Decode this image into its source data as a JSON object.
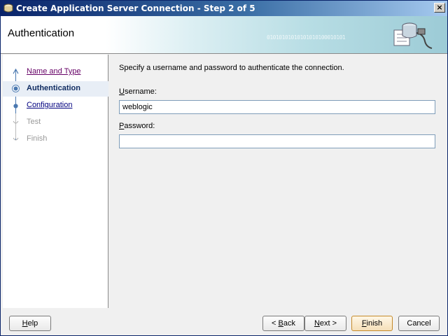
{
  "window": {
    "title": "Create Application Server Connection - Step 2 of 5",
    "close_label": "×"
  },
  "banner": {
    "title": "Authentication",
    "binary_text": "01010101010101010100010101"
  },
  "steps": [
    {
      "label": "Name and Type",
      "state": "visited"
    },
    {
      "label": "Authentication",
      "state": "current"
    },
    {
      "label": "Configuration",
      "state": "link"
    },
    {
      "label": "Test",
      "state": "disabled"
    },
    {
      "label": "Finish",
      "state": "disabled"
    }
  ],
  "content": {
    "instructions": "Specify a username and password to authenticate the connection.",
    "username": {
      "mnemonic": "U",
      "label_rest": "sername:",
      "value": "weblogic"
    },
    "password": {
      "mnemonic": "P",
      "label_rest": "assword:",
      "value": ""
    }
  },
  "buttons": {
    "help": {
      "pre": "",
      "mn": "H",
      "post": "elp"
    },
    "back": {
      "pre": "< ",
      "mn": "B",
      "post": "ack"
    },
    "next": {
      "pre": "",
      "mn": "N",
      "post": "ext >"
    },
    "finish": {
      "pre": "",
      "mn": "F",
      "post": "inish"
    },
    "cancel": {
      "pre": "",
      "mn": "",
      "post": "Cancel"
    }
  },
  "colors": {
    "titlebar_start": "#0a246a",
    "visited_link": "#660066",
    "link": "#000080",
    "current_step": "#102c62"
  }
}
